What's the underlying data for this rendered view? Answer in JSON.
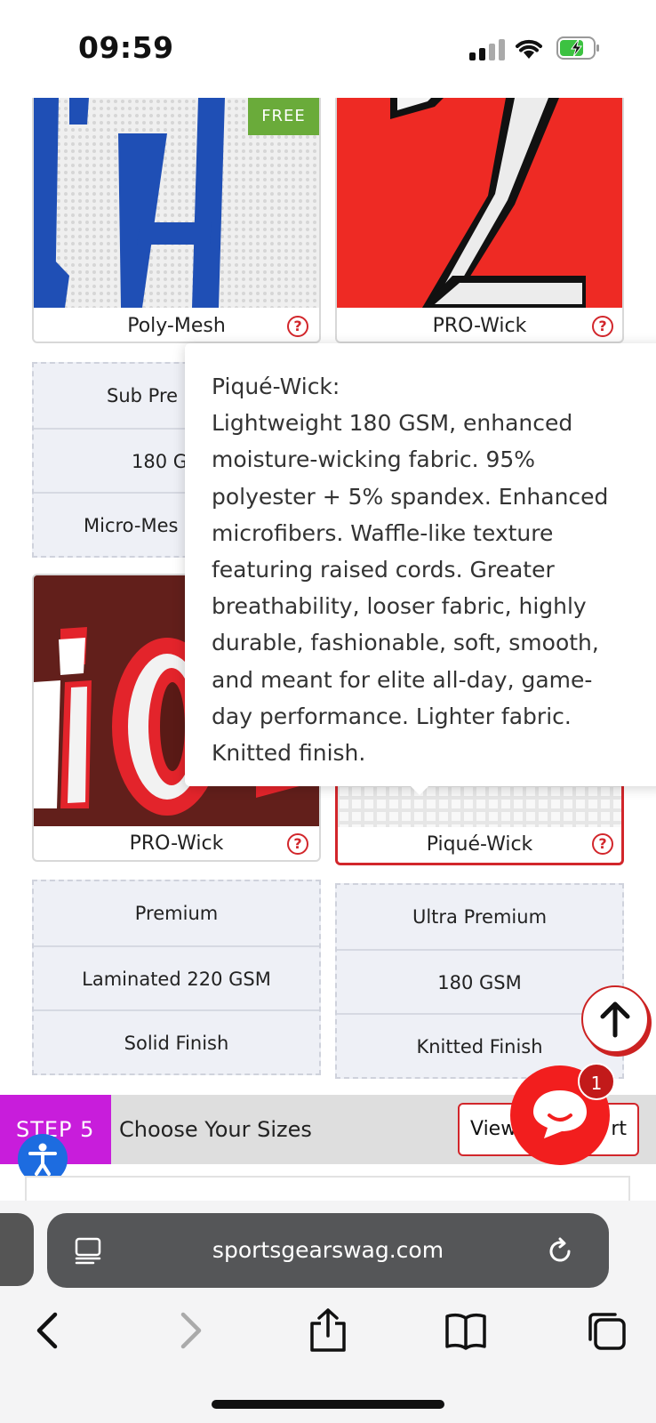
{
  "status_bar": {
    "time": "09:59"
  },
  "products": {
    "row1": [
      {
        "label": "Poly-Mesh",
        "badge": "FREE",
        "help": "?"
      },
      {
        "label": "PRO-Wick",
        "help": "?"
      }
    ],
    "row1_specs": [
      {
        "rows": [
          "Sub Pre",
          "180 G",
          "Micro-Mes"
        ]
      }
    ],
    "row2": [
      {
        "label": "PRO-Wick",
        "help": "?"
      },
      {
        "label": "Piqué-Wick",
        "help": "?",
        "selected": true
      }
    ],
    "row2_specs": [
      {
        "rows": [
          "Premium",
          "Laminated 220 GSM",
          "Solid Finish"
        ]
      },
      {
        "rows": [
          "Ultra Premium",
          "180 GSM",
          "Knitted Finish"
        ]
      }
    ]
  },
  "tooltip": {
    "lines": [
      "Piqué-Wick:",
      "Lightweight 180 GSM, enhanced",
      "moisture-wicking fabric. 95%",
      "polyester + 5% spandex. Enhanced",
      "microfibers. Waffle-like texture",
      "featuring raised cords. Greater",
      "breathability, looser fabric, highly",
      "durable, fashionable, soft, smooth,",
      "and meant for elite all-day, game-",
      "day performance. Lighter fabric.",
      "Knitted finish."
    ]
  },
  "step_bar": {
    "step": "STEP 5",
    "title": "Choose Your Sizes",
    "button_left": "View",
    "button_right": "rt"
  },
  "chat": {
    "badge_count": "1"
  },
  "browser": {
    "url": "sportsgearswag.com"
  },
  "colors": {
    "accent": "#d2262b",
    "step_tag": "#c81ddb",
    "free_badge": "#6aab3a",
    "chat": "#f21e1e",
    "a11y": "#1d6ce0"
  }
}
